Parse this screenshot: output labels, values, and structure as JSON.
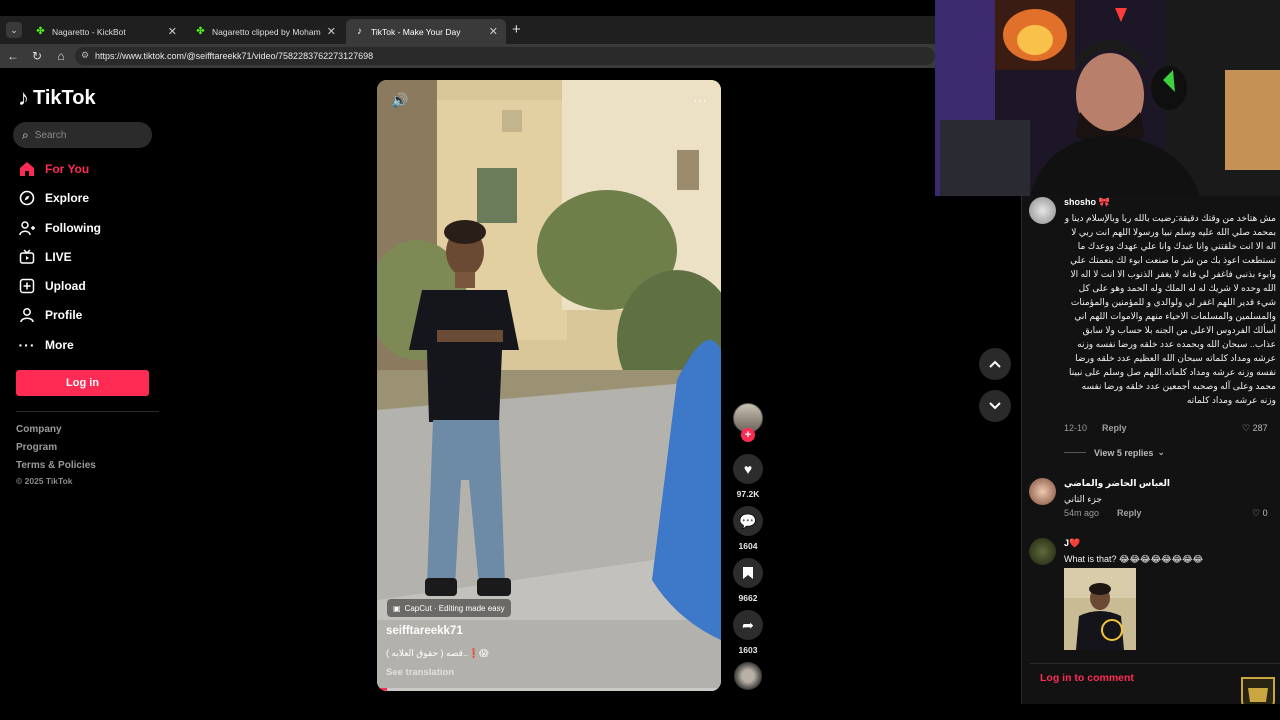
{
  "browser": {
    "tabs": [
      {
        "title": "Nagaretto - KickBot",
        "active": false,
        "favicon": "kick-icon"
      },
      {
        "title": "Nagaretto clipped by Mohamad_S",
        "active": false,
        "favicon": "kick-icon"
      },
      {
        "title": "TikTok - Make Your Day",
        "active": true,
        "favicon": "tiktok-icon"
      }
    ],
    "new_tab": "+",
    "close_glyph": "✕",
    "url": "https://www.tiktok.com/@seifftareekk71/video/7582283762273127698"
  },
  "sidebar": {
    "brand": "TikTok",
    "search_placeholder": "Search",
    "items": [
      {
        "label": "For You",
        "icon": "home-icon",
        "active": true
      },
      {
        "label": "Explore",
        "icon": "compass-icon",
        "active": false
      },
      {
        "label": "Following",
        "icon": "user-plus-icon",
        "active": false
      },
      {
        "label": "LIVE",
        "icon": "live-icon",
        "active": false
      },
      {
        "label": "Upload",
        "icon": "upload-icon",
        "active": false
      },
      {
        "label": "Profile",
        "icon": "profile-icon",
        "active": false
      },
      {
        "label": "More",
        "icon": "more-icon",
        "active": false
      }
    ],
    "login_label": "Log in",
    "footer": {
      "company": "Company",
      "program": "Program",
      "terms": "Terms & Policies",
      "copyright": "© 2025 TikTok"
    }
  },
  "video": {
    "capcut_label": "CapCut · Editing made easy",
    "author": "seifftareekk71",
    "caption": "قصه ( حقوق العلابه )..❗😱",
    "see_translation": "See translation",
    "progress": 0.03
  },
  "actions": {
    "likes": "97.2K",
    "comments": "1604",
    "saves": "9662",
    "shares": "1603"
  },
  "comments": [
    {
      "user": "shosho 🎀",
      "text": "مش هتاخد من وقتك دقيقة:رضيت بالله ربا وبالإسلام دينا و بمحمد صلي الله عليه وسلم نبيا ورسولا اللهم انت ربي لا اله الا انت خلقتني وانا عبدك وانا علي عهدك ووعدك ما تستطعت اعوذ بك من شر ما صنعت ابوء لك بنعمتك علي وابوء بذنبي فاغفر لي فانه لا يغفر الذنوب الا انت لا اله الا الله وحده لا شريك له له الملك وله الحمد وهو على كل شيء قدير اللهم اغفر لي ولوالدي و للمؤمنين والمؤمنات والمسلمين والمسلمات الاحياء منهم والاموات اللهم اني أسألك الفردوس الاعلى من الجنه بلا حساب ولا سابق عذاب.. سبحان الله وبحمده عدد خلقه ورضا نفسه وزنه عرشه ومداد كلماته سبحان الله العظيم عدد خلقه ورضا نفسه وزنه عرشه ومداد كلماته.اللهم صل وسلم على نبينا محمد وعلى آله وصحبه أجمعين عدد خلقه ورضا نفسه وزنه عرشه ومداد كلماته",
      "date": "12-10",
      "reply": "Reply",
      "likes": "287",
      "view_replies": "View 5 replies"
    },
    {
      "user": "العباس الحاضر والماضي",
      "text": "جزء التاني",
      "date": "54m ago",
      "reply": "Reply",
      "likes": "0"
    },
    {
      "user": "J❤️",
      "text": "What is that? 😂😂😂😂😂😂😂😂",
      "date": "",
      "reply": "",
      "likes": ""
    }
  ],
  "comment_login": "Log in to comment",
  "colors": {
    "accent": "#fe2c55",
    "background": "#000000",
    "panel": "#121212"
  }
}
